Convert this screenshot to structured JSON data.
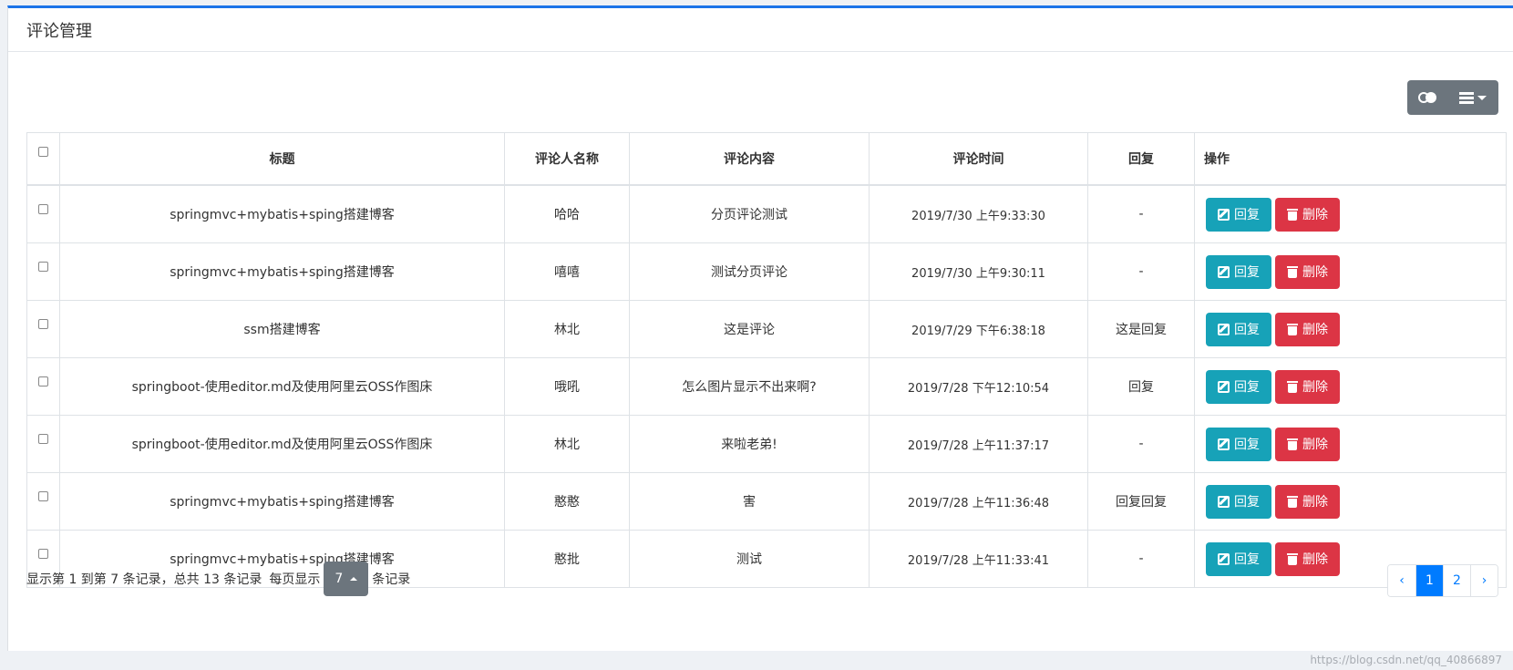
{
  "page": {
    "title": "评论管理"
  },
  "toolbar": {
    "toggle_icon": "toggle-view-icon",
    "columns_icon": "columns-list-icon"
  },
  "table": {
    "headers": [
      "标题",
      "评论人名称",
      "评论内容",
      "评论时间",
      "回复",
      "操作"
    ],
    "reply_label": "回复",
    "delete_label": "删除",
    "rows": [
      {
        "title": "springmvc+mybatis+sping搭建博客",
        "name": "哈哈",
        "content": "分页评论测试",
        "time": "2019/7/30 上午9:33:30",
        "reply": "-"
      },
      {
        "title": "springmvc+mybatis+sping搭建博客",
        "name": "嘻嘻",
        "content": "测试分页评论",
        "time": "2019/7/30 上午9:30:11",
        "reply": "-"
      },
      {
        "title": "ssm搭建博客",
        "name": "林北",
        "content": "这是评论",
        "time": "2019/7/29 下午6:38:18",
        "reply": "这是回复"
      },
      {
        "title": "springboot-使用editor.md及使用阿里云OSS作图床",
        "name": "哦吼",
        "content": "怎么图片显示不出来啊?",
        "time": "2019/7/28 下午12:10:54",
        "reply": "回复"
      },
      {
        "title": "springboot-使用editor.md及使用阿里云OSS作图床",
        "name": "林北",
        "content": "来啦老弟!",
        "time": "2019/7/28 上午11:37:17",
        "reply": "-"
      },
      {
        "title": "springmvc+mybatis+sping搭建博客",
        "name": "憨憨",
        "content": "害",
        "time": "2019/7/28 上午11:36:48",
        "reply": "回复回复"
      },
      {
        "title": "springmvc+mybatis+sping搭建博客",
        "name": "憨批",
        "content": "测试",
        "time": "2019/7/28 上午11:33:41",
        "reply": "-"
      }
    ]
  },
  "footer": {
    "info_text": "显示第 1 到第 7 条记录，总共 13 条记录",
    "per_page_prefix": "每页显示",
    "per_page_value": "7",
    "per_page_suffix": "条记录"
  },
  "pagination": {
    "prev": "‹",
    "pages": [
      "1",
      "2"
    ],
    "active": "1",
    "next": "›"
  },
  "watermark": "https://blog.csdn.net/qq_40866897",
  "colors": {
    "accent": "#1a73e8",
    "reply_btn": "#17a2b8",
    "delete_btn": "#dc3545",
    "toolbar_btn": "#6c757d",
    "page_active": "#007bff"
  }
}
